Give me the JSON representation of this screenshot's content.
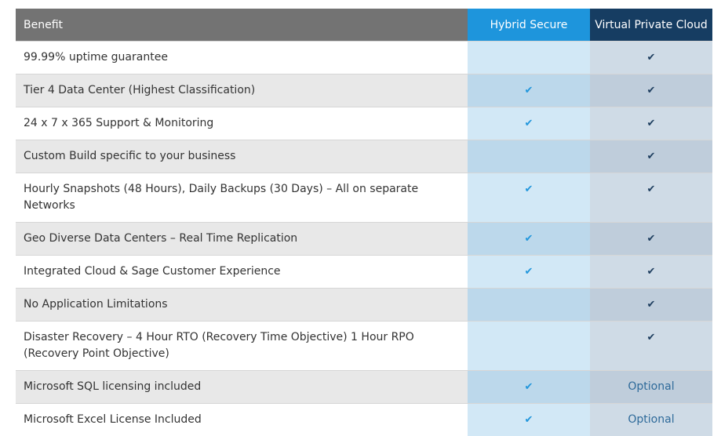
{
  "header": {
    "benefit": "Benefit",
    "hybrid": "Hybrid Secure",
    "vpc": "Virtual Private Cloud"
  },
  "colors": {
    "header_gray": "#737373",
    "header_blue": "#1e95dc",
    "header_navy": "#163d62",
    "check_blue": "#2196dc",
    "check_navy": "#1f3f60"
  },
  "check_glyph": "✔",
  "rows": [
    {
      "benefit": "99.99% uptime guarantee",
      "hybrid": "",
      "vpc": "check"
    },
    {
      "benefit": "Tier 4 Data Center (Highest Classification)",
      "hybrid": "check",
      "vpc": "check"
    },
    {
      "benefit": "24 x 7 x 365 Support & Monitoring",
      "hybrid": "check",
      "vpc": "check"
    },
    {
      "benefit": "Custom Build specific to your business",
      "hybrid": "",
      "vpc": "check"
    },
    {
      "benefit": "Hourly Snapshots (48 Hours), Daily Backups (30 Days) – All on separate Networks",
      "hybrid": "check",
      "vpc": "check"
    },
    {
      "benefit": "Geo Diverse Data Centers – Real Time Replication",
      "hybrid": "check",
      "vpc": "check"
    },
    {
      "benefit": "Integrated Cloud & Sage Customer Experience",
      "hybrid": "check",
      "vpc": "check"
    },
    {
      "benefit": "No Application Limitations",
      "hybrid": "",
      "vpc": "check"
    },
    {
      "benefit": "Disaster Recovery – 4 Hour RTO (Recovery Time Objective) 1 Hour RPO (Recovery Point Objective)",
      "hybrid": "",
      "vpc": "check"
    },
    {
      "benefit": "Microsoft SQL licensing included",
      "hybrid": "check",
      "vpc": "Optional"
    },
    {
      "benefit": "Microsoft Excel License Included",
      "hybrid": "check",
      "vpc": "Optional"
    }
  ]
}
